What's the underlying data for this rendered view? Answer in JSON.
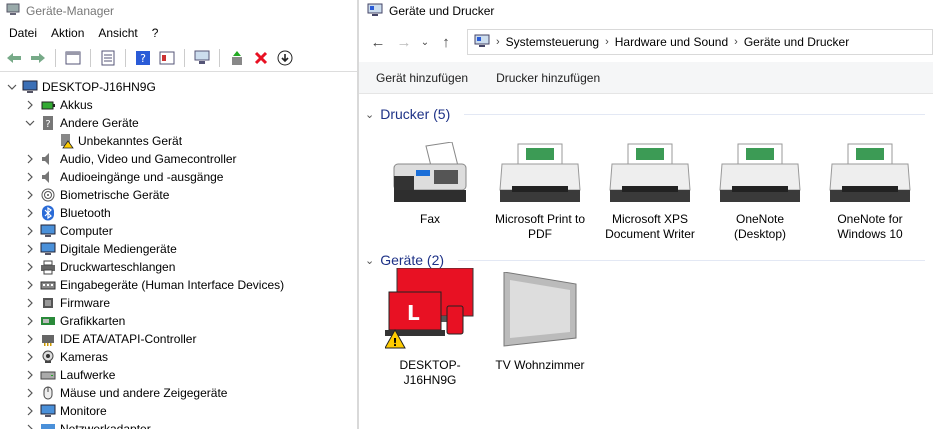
{
  "device_manager": {
    "title": "Geräte-Manager",
    "menu": [
      "Datei",
      "Aktion",
      "Ansicht",
      "?"
    ],
    "tree": [
      {
        "label": "DESKTOP-J16HN9G",
        "level": 0,
        "expanded": true,
        "icon": "computer-icon"
      },
      {
        "label": "Akkus",
        "level": 1,
        "expanded": false,
        "icon": "battery-icon"
      },
      {
        "label": "Andere Geräte",
        "level": 1,
        "expanded": true,
        "icon": "unknown-device-icon"
      },
      {
        "label": "Unbekanntes Gerät",
        "level": 2,
        "expanded": null,
        "icon": "warning-device-icon"
      },
      {
        "label": "Audio, Video und Gamecontroller",
        "level": 1,
        "expanded": false,
        "icon": "speaker-icon"
      },
      {
        "label": "Audioeingänge und -ausgänge",
        "level": 1,
        "expanded": false,
        "icon": "speaker-icon"
      },
      {
        "label": "Biometrische Geräte",
        "level": 1,
        "expanded": false,
        "icon": "fingerprint-icon"
      },
      {
        "label": "Bluetooth",
        "level": 1,
        "expanded": false,
        "icon": "bluetooth-icon"
      },
      {
        "label": "Computer",
        "level": 1,
        "expanded": false,
        "icon": "monitor-icon"
      },
      {
        "label": "Digitale Mediengeräte",
        "level": 1,
        "expanded": false,
        "icon": "monitor-icon"
      },
      {
        "label": "Druckwarteschlangen",
        "level": 1,
        "expanded": false,
        "icon": "printer-icon"
      },
      {
        "label": "Eingabegeräte (Human Interface Devices)",
        "level": 1,
        "expanded": false,
        "icon": "hid-icon"
      },
      {
        "label": "Firmware",
        "level": 1,
        "expanded": false,
        "icon": "chip-icon"
      },
      {
        "label": "Grafikkarten",
        "level": 1,
        "expanded": false,
        "icon": "display-adapter-icon"
      },
      {
        "label": "IDE ATA/ATAPI-Controller",
        "level": 1,
        "expanded": false,
        "icon": "controller-icon"
      },
      {
        "label": "Kameras",
        "level": 1,
        "expanded": false,
        "icon": "camera-icon"
      },
      {
        "label": "Laufwerke",
        "level": 1,
        "expanded": false,
        "icon": "drive-icon"
      },
      {
        "label": "Mäuse und andere Zeigegeräte",
        "level": 1,
        "expanded": false,
        "icon": "mouse-icon"
      },
      {
        "label": "Monitore",
        "level": 1,
        "expanded": false,
        "icon": "monitor-icon"
      },
      {
        "label": "Netzwerkadapter",
        "level": 1,
        "expanded": false,
        "icon": "network-icon"
      }
    ]
  },
  "devices_printers": {
    "title": "Geräte und Drucker",
    "breadcrumb": [
      "Systemsteuerung",
      "Hardware und Sound",
      "Geräte und Drucker"
    ],
    "commands": [
      "Gerät hinzufügen",
      "Drucker hinzufügen"
    ],
    "printers_group": "Drucker (5)",
    "printers": [
      {
        "label": "Fax",
        "type": "fax"
      },
      {
        "label": "Microsoft Print to PDF",
        "type": "printer"
      },
      {
        "label": "Microsoft XPS Document Writer",
        "type": "printer"
      },
      {
        "label": "OneNote (Desktop)",
        "type": "printer"
      },
      {
        "label": "OneNote for Windows 10",
        "type": "printer"
      }
    ],
    "devices_group": "Geräte (2)",
    "devices": [
      {
        "label": "DESKTOP-J16HN9G",
        "type": "computer"
      },
      {
        "label": "TV Wohnzimmer",
        "type": "tv"
      }
    ]
  },
  "colors": {
    "accent": "#1e3287",
    "alert_red": "#e81123",
    "warning_yellow": "#ffcc00"
  }
}
